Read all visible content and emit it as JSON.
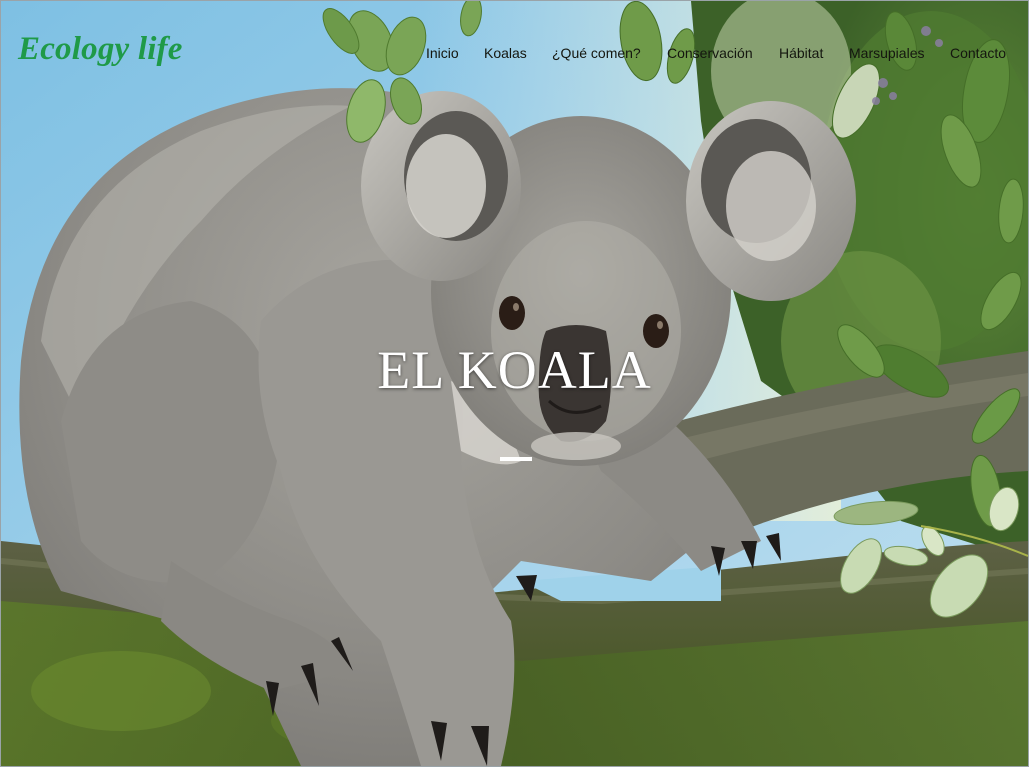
{
  "brand": {
    "name": "Ecology life"
  },
  "nav": {
    "items": [
      {
        "label": "Inicio"
      },
      {
        "label": "Koalas"
      },
      {
        "label": "¿Qué comen?"
      },
      {
        "label": "Conservación"
      },
      {
        "label": "Hábitat"
      },
      {
        "label": "Marsupiales"
      },
      {
        "label": "Contacto"
      }
    ]
  },
  "hero": {
    "title": "EL KOALA"
  },
  "colors": {
    "brand": "#1f9a48",
    "nav_text": "#14160f",
    "hero_text": "#ffffff",
    "sky": "#8fcbe9"
  }
}
